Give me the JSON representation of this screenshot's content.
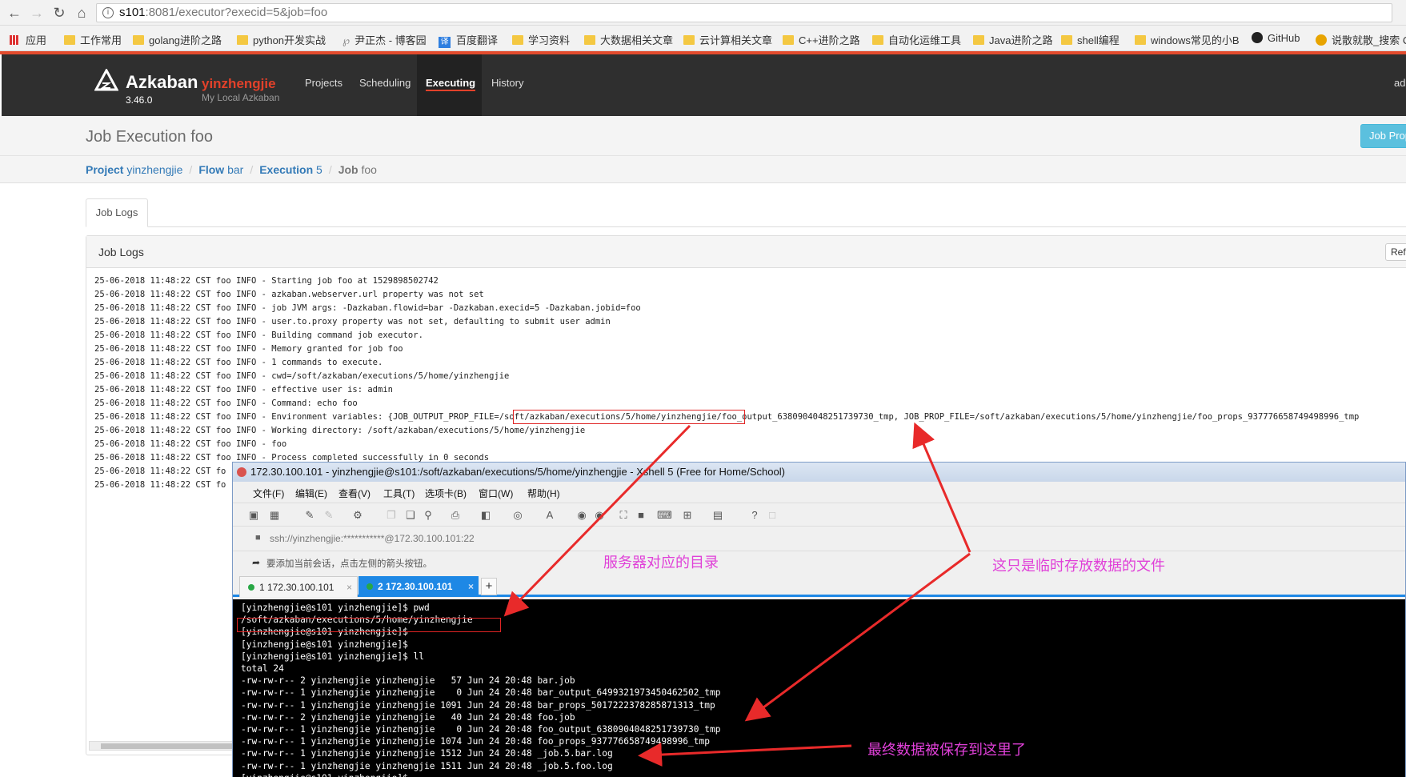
{
  "browser": {
    "url_host": "s101",
    "url_rest": ":8081/executor?execid=5&job=foo",
    "bookmarks": [
      "应用",
      "工作常用",
      "golang进阶之路",
      "python开发实战",
      "尹正杰 - 博客园",
      "百度翻译",
      "学习资料",
      "大数据相关文章",
      "云计算相关文章",
      "C++进阶之路",
      "自动化运维工具",
      "Java进阶之路",
      "shell编程",
      "windows常见的小B",
      "GitHub",
      "说散就散_搜索 C"
    ]
  },
  "azkaban": {
    "name": "Azkaban",
    "user": "yinzhengjie",
    "version": "3.46.0",
    "subtitle": "My Local Azkaban",
    "nav": [
      "Projects",
      "Scheduling",
      "Executing",
      "History"
    ],
    "right": "adi"
  },
  "page": {
    "title": "Job Execution foo",
    "job_prop_button": "Job Prop",
    "breadcrumb": {
      "project_label": "Project",
      "project": "yinzhengjie",
      "flow_label": "Flow",
      "flow": "bar",
      "execution_label": "Execution",
      "execution": "5",
      "job_label": "Job",
      "job": "foo"
    },
    "tab": "Job Logs",
    "panel_title": "Job Logs",
    "refresh_button": "Refr"
  },
  "logs": [
    "25-06-2018 11:48:22 CST foo INFO - Starting job foo at 1529898502742",
    "25-06-2018 11:48:22 CST foo INFO - azkaban.webserver.url property was not set",
    "25-06-2018 11:48:22 CST foo INFO - job JVM args: -Dazkaban.flowid=bar -Dazkaban.execid=5 -Dazkaban.jobid=foo",
    "25-06-2018 11:48:22 CST foo INFO - user.to.proxy property was not set, defaulting to submit user admin",
    "25-06-2018 11:48:22 CST foo INFO - Building command job executor.",
    "25-06-2018 11:48:22 CST foo INFO - Memory granted for job foo",
    "25-06-2018 11:48:22 CST foo INFO - 1 commands to execute.",
    "25-06-2018 11:48:22 CST foo INFO - cwd=/soft/azkaban/executions/5/home/yinzhengjie",
    "25-06-2018 11:48:22 CST foo INFO - effective user is: admin",
    "25-06-2018 11:48:22 CST foo INFO - Command: echo foo",
    "25-06-2018 11:48:22 CST foo INFO - Environment variables: {JOB_OUTPUT_PROP_FILE=/soft/azkaban/executions/5/home/yinzhengjie/foo_output_6380904048251739730_tmp, JOB_PROP_FILE=/soft/azkaban/executions/5/home/yinzhengjie/foo_props_937776658749498996_tmp",
    "25-06-2018 11:48:22 CST foo INFO - Working directory: /soft/azkaban/executions/5/home/yinzhengjie",
    "25-06-2018 11:48:22 CST foo INFO - foo",
    "25-06-2018 11:48:22 CST foo INFO - Process completed successfully in 0 seconds",
    "25-06-2018 11:48:22 CST fo",
    "25-06-2018 11:48:22 CST fo"
  ],
  "xshell": {
    "title": "172.30.100.101 - yinzhengjie@s101:/soft/azkaban/executions/5/home/yinzhengjie - Xshell 5 (Free for Home/School)",
    "menu": [
      "文件(F)",
      "编辑(E)",
      "查看(V)",
      "工具(T)",
      "选项卡(B)",
      "窗口(W)",
      "帮助(H)"
    ],
    "address": "ssh://yinzhengjie:***********@172.30.100.101:22",
    "hint": "要添加当前会话，点击左侧的箭头按钮。",
    "tabs": [
      "1 172.30.100.101",
      "2 172.30.100.101"
    ],
    "terminal": [
      "[yinzhengjie@s101 yinzhengjie]$ pwd",
      "/soft/azkaban/executions/5/home/yinzhengjie",
      "[yinzhengjie@s101 yinzhengjie]$",
      "[yinzhengjie@s101 yinzhengjie]$",
      "[yinzhengjie@s101 yinzhengjie]$ ll",
      "total 24",
      "-rw-rw-r-- 2 yinzhengjie yinzhengjie   57 Jun 24 20:48 bar.job",
      "-rw-rw-r-- 1 yinzhengjie yinzhengjie    0 Jun 24 20:48 bar_output_6499321973450462502_tmp",
      "-rw-rw-r-- 1 yinzhengjie yinzhengjie 1091 Jun 24 20:48 bar_props_5017222378285871313_tmp",
      "-rw-rw-r-- 2 yinzhengjie yinzhengjie   40 Jun 24 20:48 foo.job",
      "-rw-rw-r-- 1 yinzhengjie yinzhengjie    0 Jun 24 20:48 foo_output_6380904048251739730_tmp",
      "-rw-rw-r-- 1 yinzhengjie yinzhengjie 1074 Jun 24 20:48 foo_props_937776658749498996_tmp",
      "-rw-rw-r-- 1 yinzhengjie yinzhengjie 1512 Jun 24 20:48 _job.5.bar.log",
      "-rw-rw-r-- 1 yinzhengjie yinzhengjie 1511 Jun 24 20:48 _job.5.foo.log",
      "[yinzhengjie@s101 yinzhengjie]$"
    ]
  },
  "annotations": {
    "server_dir": "服务器对应的目录",
    "temp_file": "这只是临时存放数据的文件",
    "final_data": "最终数据被保存到这里了",
    "color": "#e040d8",
    "arrow_color": "#e82a2a"
  }
}
